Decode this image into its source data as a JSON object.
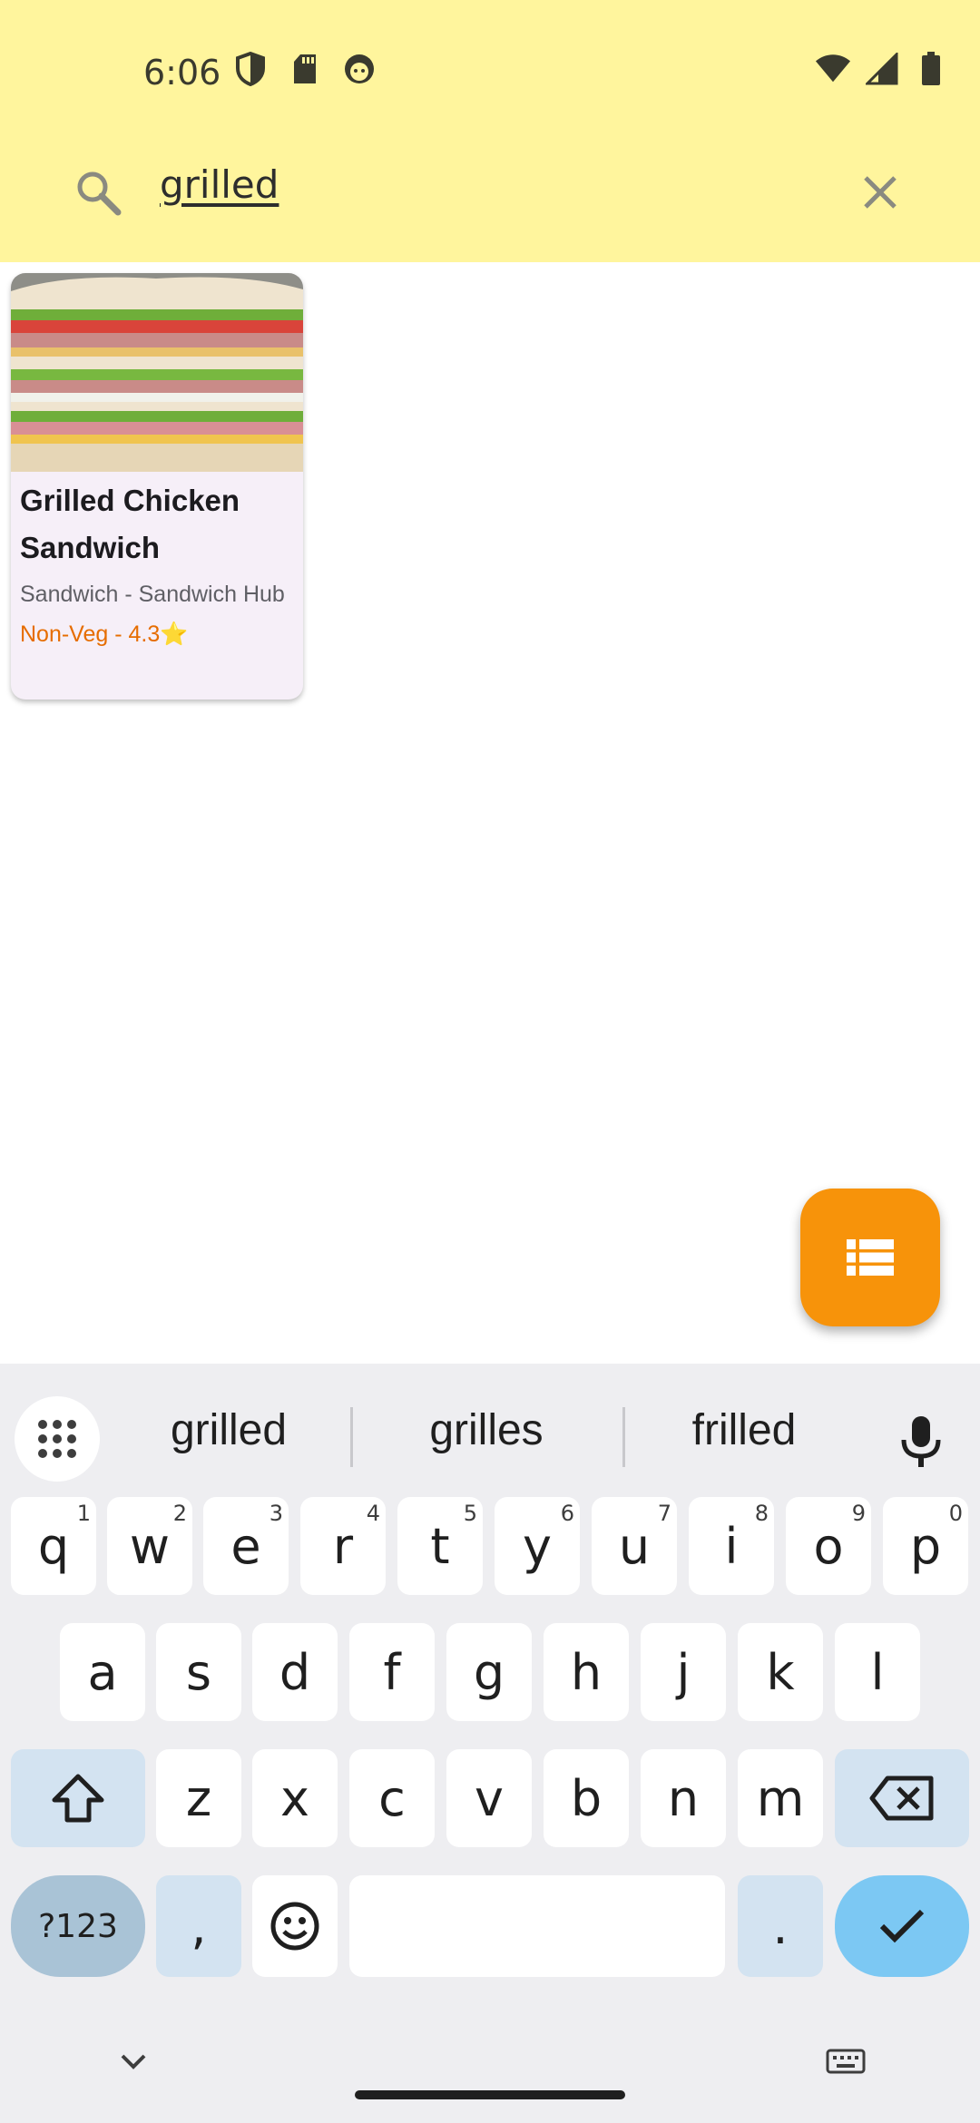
{
  "status_bar": {
    "time": "6:06",
    "left_icons": [
      "shield-icon",
      "sd-card-icon",
      "face-icon"
    ],
    "right_icons": [
      "wifi-icon",
      "signal-icon",
      "battery-icon"
    ]
  },
  "search": {
    "query": "grilled",
    "search_icon": "search-icon",
    "clear_icon": "close-icon"
  },
  "results": [
    {
      "title": "Grilled Chicken Sandwich",
      "category": "Sandwich - Sandwich Hub",
      "meta": "Non-Veg - 4.3⭐"
    }
  ],
  "fab": {
    "icon": "list-view-icon",
    "color": "#f7930a"
  },
  "keyboard": {
    "suggestions": [
      "grilled",
      "grilles",
      "frilled"
    ],
    "row1": [
      {
        "k": "q",
        "n": "1"
      },
      {
        "k": "w",
        "n": "2"
      },
      {
        "k": "e",
        "n": "3"
      },
      {
        "k": "r",
        "n": "4"
      },
      {
        "k": "t",
        "n": "5"
      },
      {
        "k": "y",
        "n": "6"
      },
      {
        "k": "u",
        "n": "7"
      },
      {
        "k": "i",
        "n": "8"
      },
      {
        "k": "o",
        "n": "9"
      },
      {
        "k": "p",
        "n": "0"
      }
    ],
    "row2": [
      "a",
      "s",
      "d",
      "f",
      "g",
      "h",
      "j",
      "k",
      "l"
    ],
    "row3": [
      "z",
      "x",
      "c",
      "v",
      "b",
      "n",
      "m"
    ],
    "symbols_label": "?123",
    "comma": ",",
    "period": "."
  },
  "colors": {
    "topbar": "#fff59d",
    "accent_text": "#e66d00",
    "enter_key": "#7cc8f3"
  }
}
